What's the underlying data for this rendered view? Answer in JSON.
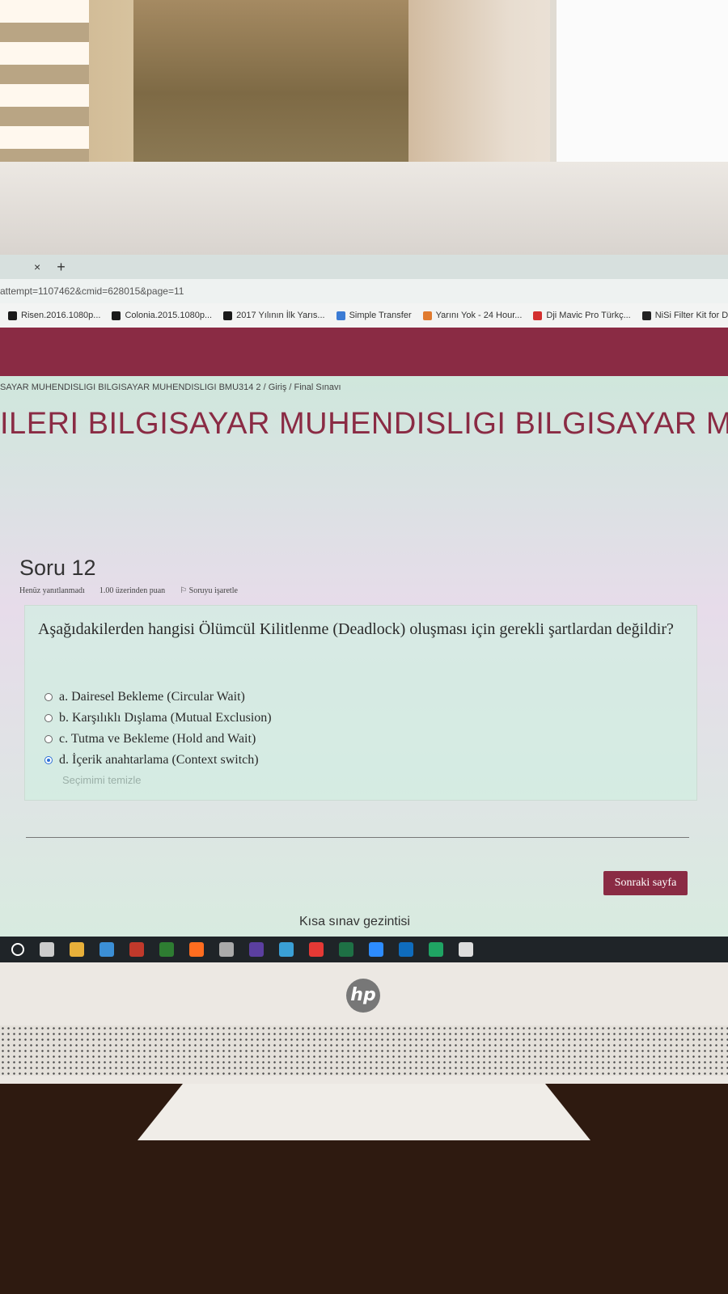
{
  "browser": {
    "tab_close": "×",
    "tab_new": "+",
    "url": "attempt=1107462&cmid=628015&page=11",
    "bookmarks": [
      {
        "label": "Risen.2016.1080p...",
        "icon_color": "#1a1a1a"
      },
      {
        "label": "Colonia.2015.1080p...",
        "icon_color": "#1a1a1a"
      },
      {
        "label": "2017 Yılının İlk Yarıs...",
        "icon_color": "#1a1a1a"
      },
      {
        "label": "Simple Transfer",
        "icon_color": "#3b7bd4"
      },
      {
        "label": "Yarını Yok - 24 Hour...",
        "icon_color": "#e07a2e"
      },
      {
        "label": "Dji Mavic Pro Türkç...",
        "icon_color": "#d32f2f"
      },
      {
        "label": "NiSi Filter Kit for DJI...",
        "icon_color": "#222222"
      }
    ]
  },
  "page": {
    "breadcrumb": "SAYAR MUHENDISLIGI BILGISAYAR MUHENDISLIGI BMU314 2  /  Giriş  /  Final Sınavı",
    "course_title": "ILERI BILGISAYAR MUHENDISLIGI BILGISAYAR MUHEN",
    "question": {
      "heading": "Soru 12",
      "status": "Henüz yanıtlanmadı",
      "points": "1.00 üzerinden puan",
      "flag": "Soruyu işaretle",
      "text": "Aşağıdakilerden hangisi Ölümcül Kilitlenme (Deadlock) oluşması için gerekli şartlardan değildir?",
      "options": [
        {
          "label": "a. Dairesel Bekleme (Circular Wait)",
          "selected": false
        },
        {
          "label": "b. Karşılıklı Dışlama (Mutual Exclusion)",
          "selected": false
        },
        {
          "label": "c. Tutma ve Bekleme (Hold and Wait)",
          "selected": false
        },
        {
          "label": "d. İçerik anahtarlama (Context switch)",
          "selected": true
        }
      ],
      "clear_choice": "Seçimimi temizle"
    },
    "next_button": "Sonraki sayfa",
    "quiz_nav": "Kısa sınav gezintisi"
  },
  "colors": {
    "brand": "#8a2b44",
    "selected_radio": "#2c6fd6"
  },
  "taskbar_icons": [
    "search-icon",
    "task-view-icon",
    "file-explorer-icon",
    "edge-legacy-icon",
    "app-icon",
    "calculator-icon",
    "firefox-icon",
    "store-icon",
    "visual-studio-icon",
    "media-player-icon",
    "chrome-icon",
    "excel-icon",
    "zoom-icon",
    "outlook-icon",
    "edge-icon",
    "app2-icon"
  ],
  "monitor_brand": "hp"
}
